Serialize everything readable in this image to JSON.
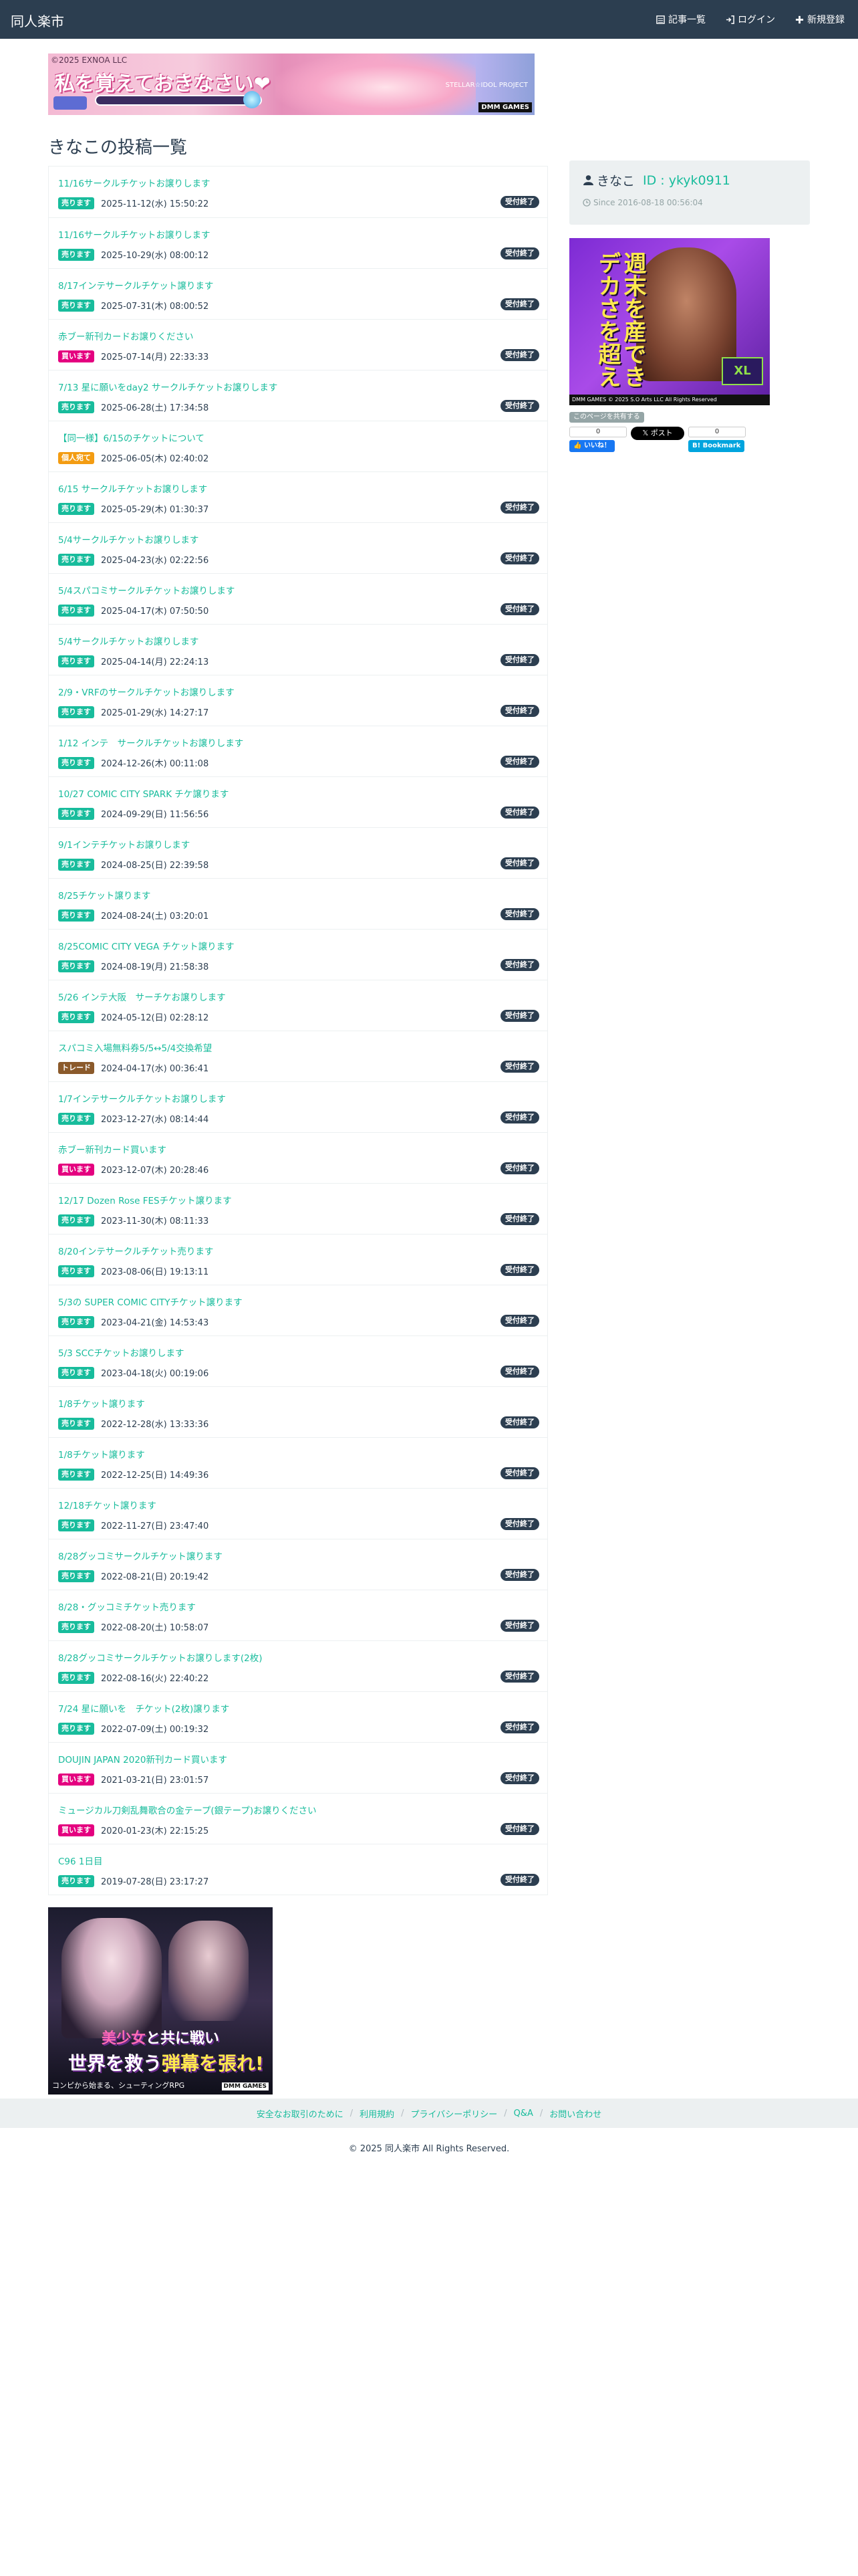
{
  "navbar": {
    "brand": "同人楽市",
    "links": [
      {
        "label": "記事一覧",
        "icon": "list-icon"
      },
      {
        "label": "ログイン",
        "icon": "login-icon"
      },
      {
        "label": "新規登録",
        "icon": "plus-icon"
      }
    ]
  },
  "ads": {
    "top": {
      "corp": "©2025 EXNOA LLC",
      "headline": "私を覚えておきなさい❤",
      "tag": "STELLAR☆IDOL PROJECT",
      "brand": "DMM GAMES"
    },
    "side": {
      "headline": "週末を産できデカさを超え",
      "badge": "XL",
      "footer": "DMM GAMES © 2025 S.O Arts LLC All Rights Reserved"
    },
    "bottom": {
      "line1_a": "美少女",
      "line1_b": "と共に戦い",
      "line2_a": "世界を救う",
      "line2_b": "弾幕を張れ!",
      "line3": "コンピから始まる、シューティングRPG",
      "brand": "DMM GAMES"
    }
  },
  "page": {
    "title": "きなこの投稿一覧"
  },
  "posts": [
    {
      "title": "11/16サークルチケットお譲りします",
      "badge": "売ります",
      "date": "2025-11-12(水) 15:50:22",
      "status": "受付終了"
    },
    {
      "title": "11/16サークルチケットお譲りします",
      "badge": "売ります",
      "date": "2025-10-29(水) 08:00:12",
      "status": "受付終了"
    },
    {
      "title": "8/17インテサークルチケット譲ります",
      "badge": "売ります",
      "date": "2025-07-31(木) 08:00:52",
      "status": "受付終了"
    },
    {
      "title": "赤ブー新刊カードお譲りください",
      "badge": "買います",
      "date": "2025-07-14(月) 22:33:33",
      "status": "受付終了"
    },
    {
      "title": "7/13 星に願いをday2 サークルチケットお譲りします",
      "badge": "売ります",
      "date": "2025-06-28(土) 17:34:58",
      "status": "受付終了"
    },
    {
      "title": "【同一様】6/15のチケットについて",
      "badge": "個人宛て",
      "date": "2025-06-05(木) 02:40:02",
      "status": ""
    },
    {
      "title": "6/15 サークルチケットお譲りします",
      "badge": "売ります",
      "date": "2025-05-29(木) 01:30:37",
      "status": "受付終了"
    },
    {
      "title": "5/4サークルチケットお譲りします",
      "badge": "売ります",
      "date": "2025-04-23(水) 02:22:56",
      "status": "受付終了"
    },
    {
      "title": "5/4スパコミサークルチケットお譲りします",
      "badge": "売ります",
      "date": "2025-04-17(木) 07:50:50",
      "status": "受付終了"
    },
    {
      "title": "5/4サークルチケットお譲りします",
      "badge": "売ります",
      "date": "2025-04-14(月) 22:24:13",
      "status": "受付終了"
    },
    {
      "title": "2/9・VRFのサークルチケットお譲りします",
      "badge": "売ります",
      "date": "2025-01-29(水) 14:27:17",
      "status": "受付終了"
    },
    {
      "title": "1/12 インテ　サークルチケットお譲りします",
      "badge": "売ります",
      "date": "2024-12-26(木) 00:11:08",
      "status": "受付終了"
    },
    {
      "title": "10/27 COMIC CITY SPARK チケ譲ります",
      "badge": "売ります",
      "date": "2024-09-29(日) 11:56:56",
      "status": "受付終了"
    },
    {
      "title": "9/1インテチケットお譲りします",
      "badge": "売ります",
      "date": "2024-08-25(日) 22:39:58",
      "status": "受付終了"
    },
    {
      "title": "8/25チケット譲ります",
      "badge": "売ります",
      "date": "2024-08-24(土) 03:20:01",
      "status": "受付終了"
    },
    {
      "title": "8/25COMIC CITY VEGA チケット譲ります",
      "badge": "売ります",
      "date": "2024-08-19(月) 21:58:38",
      "status": "受付終了"
    },
    {
      "title": "5/26 インテ大阪　サーチケお譲りします",
      "badge": "売ります",
      "date": "2024-05-12(日) 02:28:12",
      "status": "受付終了"
    },
    {
      "title": "スパコミ入場無料券5/5↔︎5/4交換希望",
      "badge": "トレード",
      "date": "2024-04-17(水) 00:36:41",
      "status": "受付終了"
    },
    {
      "title": "1/7インテサークルチケットお譲りします",
      "badge": "売ります",
      "date": "2023-12-27(水) 08:14:44",
      "status": "受付終了"
    },
    {
      "title": "赤ブー新刊カード買います",
      "badge": "買います",
      "date": "2023-12-07(木) 20:28:46",
      "status": "受付終了"
    },
    {
      "title": "12/17 Dozen Rose FESチケット譲ります",
      "badge": "売ります",
      "date": "2023-11-30(木) 08:11:33",
      "status": "受付終了"
    },
    {
      "title": "8/20インテサークルチケット売ります",
      "badge": "売ります",
      "date": "2023-08-06(日) 19:13:11",
      "status": "受付終了"
    },
    {
      "title": "5/3の SUPER COMIC CITYチケット譲ります",
      "badge": "売ります",
      "date": "2023-04-21(金) 14:53:43",
      "status": "受付終了"
    },
    {
      "title": "5/3 SCCチケットお譲りします",
      "badge": "売ります",
      "date": "2023-04-18(火) 00:19:06",
      "status": "受付終了"
    },
    {
      "title": "1/8チケット譲ります",
      "badge": "売ります",
      "date": "2022-12-28(水) 13:33:36",
      "status": "受付終了"
    },
    {
      "title": "1/8チケット譲ります",
      "badge": "売ります",
      "date": "2022-12-25(日) 14:49:36",
      "status": "受付終了"
    },
    {
      "title": "12/18チケット譲ります",
      "badge": "売ります",
      "date": "2022-11-27(日) 23:47:40",
      "status": "受付終了"
    },
    {
      "title": "8/28グッコミサークルチケット譲ります",
      "badge": "売ります",
      "date": "2022-08-21(日) 20:19:42",
      "status": "受付終了"
    },
    {
      "title": "8/28・グッコミチケット売ります",
      "badge": "売ります",
      "date": "2022-08-20(土) 10:58:07",
      "status": "受付終了"
    },
    {
      "title": "8/28グッコミサークルチケットお譲りします(2枚)",
      "badge": "売ります",
      "date": "2022-08-16(火) 22:40:22",
      "status": "受付終了"
    },
    {
      "title": "7/24 星に願いを　チケット(2枚)譲ります",
      "badge": "売ります",
      "date": "2022-07-09(土) 00:19:32",
      "status": "受付終了"
    },
    {
      "title": "DOUJIN JAPAN 2020新刊カード買います",
      "badge": "買います",
      "date": "2021-03-21(日) 23:01:57",
      "status": "受付終了"
    },
    {
      "title": "ミュージカル刀剣乱舞歌合の金テープ(銀テープ)お譲りください",
      "badge": "買います",
      "date": "2020-01-23(木) 22:15:25",
      "status": "受付終了"
    },
    {
      "title": "C96 1日目",
      "badge": "売ります",
      "date": "2019-07-28(日) 23:17:27",
      "status": "受付終了"
    }
  ],
  "badge_colors": {
    "売ります": "#18bc9c",
    "買います": "#e4007f",
    "個人宛て": "#f39c12",
    "トレード": "#8b5a2b"
  },
  "profile": {
    "name": "きなこ",
    "id": "ID : ykyk0911",
    "since": "Since 2016-08-18 00:56:04"
  },
  "share": {
    "label": "このページを共有する",
    "fb_count": "0",
    "fb_label": "いいね！",
    "x_label": "ポスト",
    "hb_count": "0",
    "hb_label": "Bookmark"
  },
  "footer": {
    "links": [
      "安全なお取引のために",
      "利用規約",
      "プライバシーポリシー",
      "Q&A",
      "お問い合わせ"
    ],
    "copyright": "© 2025 同人楽市 All Rights Reserved."
  }
}
